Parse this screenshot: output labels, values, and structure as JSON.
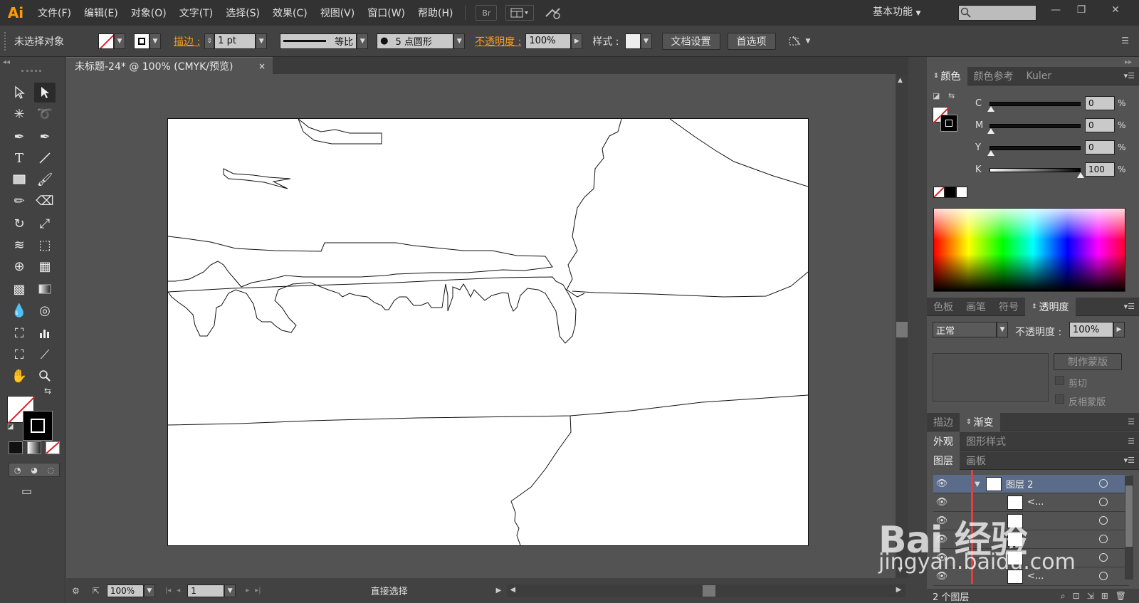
{
  "app": {
    "logo": "Ai",
    "menus": [
      "文件(F)",
      "编辑(E)",
      "对象(O)",
      "文字(T)",
      "选择(S)",
      "效果(C)",
      "视图(V)",
      "窗口(W)",
      "帮助(H)"
    ],
    "bridge_label": "Br",
    "workspace": "基本功能",
    "window_controls": [
      "—",
      "❐",
      "✕"
    ]
  },
  "control": {
    "selection_status": "未选择对象",
    "stroke_label": "描边 :",
    "stroke_weight": "1 pt",
    "profile_label": "等比",
    "brush_label": "5 点圆形",
    "opacity_label": "不透明度 :",
    "opacity_value": "100%",
    "style_label": "样式 :",
    "doc_setup_button": "文档设置",
    "prefs_button": "首选项"
  },
  "document": {
    "tab_title": "未标题-24* @ 100% (CMYK/预览)",
    "tab_close": "×"
  },
  "status": {
    "zoom": "100%",
    "artboard_num": "1",
    "tool_name": "直接选择"
  },
  "color_panel": {
    "tabs": [
      "颜色",
      "颜色参考",
      "Kuler"
    ],
    "channels": [
      {
        "label": "C",
        "value": "0",
        "level": 0
      },
      {
        "label": "M",
        "value": "0",
        "level": 0
      },
      {
        "label": "Y",
        "value": "0",
        "level": 0
      },
      {
        "label": "K",
        "value": "100",
        "level": 1
      }
    ],
    "percent": "%"
  },
  "transparency_panel": {
    "tabs": [
      "色板",
      "画笔",
      "符号",
      "透明度"
    ],
    "blend_mode": "正常",
    "opacity_label": "不透明度 :",
    "opacity_value": "100%",
    "make_mask_button": "制作蒙版",
    "clip_label": "剪切",
    "invert_label": "反相蒙版"
  },
  "stroke_gradient_tabs": [
    "描边",
    "渐变"
  ],
  "appearance_tabs": [
    "外观",
    "图形样式"
  ],
  "layers_panel": {
    "tabs": [
      "图层",
      "画板"
    ],
    "rows": [
      {
        "name": "图层 2"
      },
      {
        "name": "<..."
      },
      {
        "name": ""
      },
      {
        "name": ""
      },
      {
        "name": ""
      },
      {
        "name": "<..."
      }
    ],
    "footer": "2 个图层"
  },
  "watermark": {
    "line1": "Bai 经验",
    "line2": "jingyan.baidu.com"
  }
}
